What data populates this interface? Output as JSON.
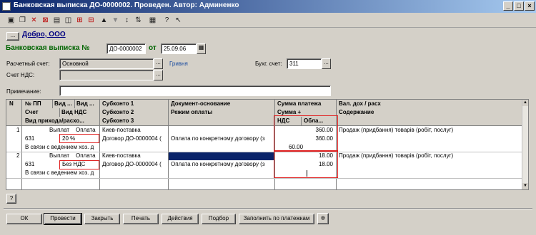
{
  "window": {
    "title": "Банковская выписка ДО-0000002. Проведен. Автор: Админенко",
    "controls": [
      "_",
      "□",
      "×"
    ]
  },
  "toolbar": {
    "icons": [
      "new-icon",
      "copy-icon",
      "delete-icon",
      "mark-icon",
      "doc-icon",
      "save-icon",
      "post-icon",
      "up-icon",
      "down-icon",
      "sort-az-icon",
      "sort-za-icon",
      "help-icon",
      "pointer-help-icon"
    ]
  },
  "header": {
    "org_button": "...",
    "org_name": "Добро, ООО",
    "doc_title": "Банковская выписка №",
    "doc_number": "ДО-0000002",
    "date_label": "от",
    "date_value": "25.09.06"
  },
  "form": {
    "account_label": "Расчетный счет:",
    "account_value": "Основной",
    "currency": "Гривня",
    "buh_label": "Бухг. счет:",
    "buh_value": "311",
    "vat_label": "Счет НДС:",
    "vat_value": "",
    "note_label": "Примечание:",
    "note_value": ""
  },
  "table": {
    "headers": {
      "n": "N",
      "row1": [
        "№ ПП",
        "Вид ...",
        "Вид ...",
        "Субконто 1",
        "Документ-основание",
        "Сумма платежа",
        "Вал. дох / расх"
      ],
      "row2": [
        "Счет",
        "Вид НДС",
        "Субконто 2",
        "Режим оплаты",
        "Сумма +",
        "Содержание"
      ],
      "row3": [
        "Вид прихода/расхо...",
        "Субконто 3",
        "НДС",
        "Обла..."
      ]
    },
    "rows": [
      {
        "n": "1",
        "kind": "Выплат",
        "kind2": "Оплата",
        "account": "631",
        "vat_kind": "20 %",
        "reason": "В связи с ведением хоз. д",
        "sub1": "Киев-поставка",
        "sub2": "Договор ДО-0000004 (",
        "doc": "",
        "mode": "Оплата по конкретному договору (з",
        "sum": "360.00",
        "sum_plus": "360.00",
        "vat": "60.00",
        "content": "Продаж (придбання) товарів (робіт, послуг)"
      },
      {
        "n": "2",
        "kind": "Выплат",
        "kind2": "Оплата",
        "account": "631",
        "vat_kind": "Без НДС",
        "reason": "В связи с ведением хоз. д",
        "sub1": "Киев-поставка",
        "sub2": "Договор ДО-0000004 (",
        "doc": "",
        "mode": "Оплата по конкретному договору (з",
        "sum": "18.00",
        "sum_plus": "18.00",
        "vat": "",
        "content": "Продаж (придбання) товарів (робіт, послуг)"
      }
    ]
  },
  "buttons": {
    "help": "?",
    "ok": "ОК",
    "post": "Провести",
    "close": "Закрыть",
    "print": "Печать",
    "actions": "Действия",
    "select": "Подбор",
    "fill": "Заполнить по платежкам"
  },
  "colors": {
    "title_start": "#0a246a",
    "title_end": "#a6caf0",
    "doc_title": "#006400",
    "highlight": "#e02020",
    "selection": "#0a246a"
  }
}
